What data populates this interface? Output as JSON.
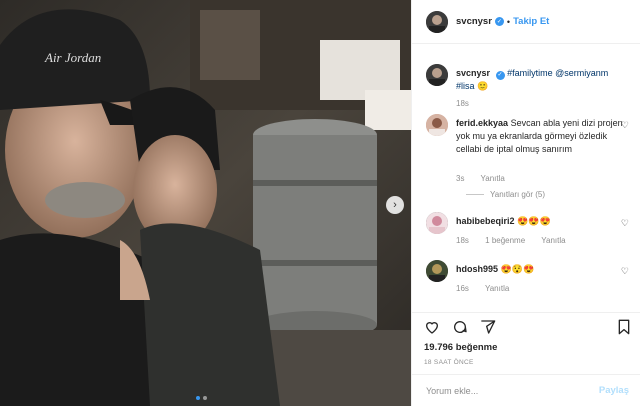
{
  "post": {
    "username": "svcnysr",
    "follow_label": "Takip Et",
    "caption": {
      "username": "svcnysr",
      "tags": "#familytime @sermiyanm #lisa",
      "emoji": "🙂",
      "time": "18s"
    },
    "comments": [
      {
        "username": "ferid.ekkyaa",
        "text": "Sevcan abla yeni dizi projen yok mu ya ekranlarda görmeyi özledik cellabi de iptal olmuş sanırım",
        "time": "3s",
        "reply_label": "Yanıtla",
        "view_replies": "Yanıtları gör (5)"
      },
      {
        "username": "habibebeqiri2",
        "text": "😍😍😍",
        "time": "18s",
        "likes": "1 beğenme",
        "reply_label": "Yanıtla"
      },
      {
        "username": "hdosh995",
        "text": "😍😯😍",
        "time": "16s",
        "reply_label": "Yanıtla"
      }
    ],
    "likes_text": "19.796 beğenme",
    "posted_ago": "18 SAAT ÖNCE",
    "comment_placeholder": "Yorum ekle...",
    "post_button": "Paylaş",
    "icons": [
      "heart-icon",
      "comment-icon",
      "share-icon",
      "bookmark-icon"
    ],
    "carousel": {
      "slides": 2,
      "active_index": 0
    },
    "colors": {
      "accent": "#3897f0",
      "post_disabled": "#b2dffc"
    },
    "photo_cap_text": "Air Jordan"
  }
}
